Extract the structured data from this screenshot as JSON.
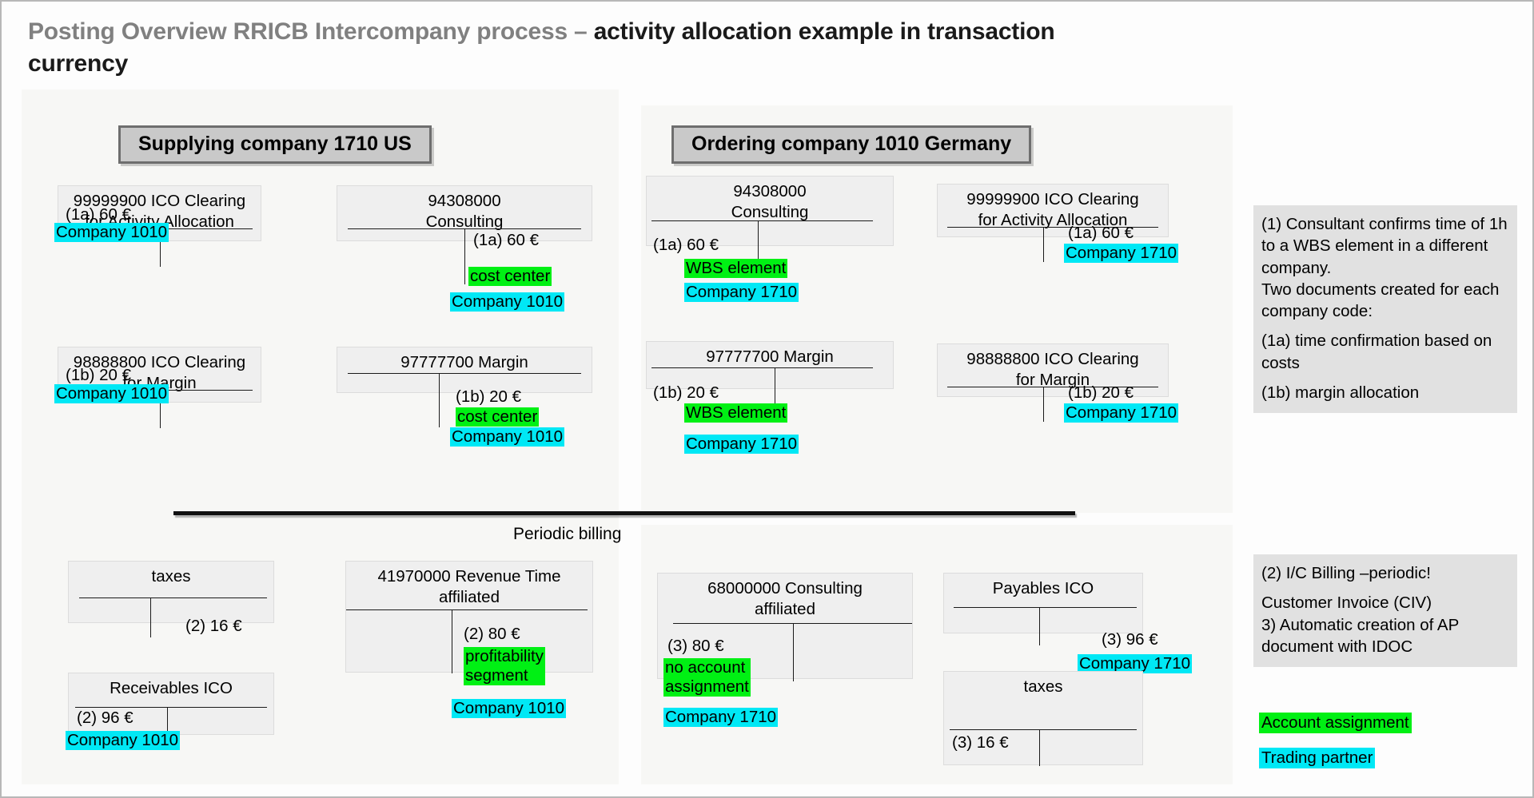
{
  "title": {
    "lead": "Posting Overview RRICB Intercompany process – ",
    "accent": "activity allocation example in transaction currency"
  },
  "colors": {
    "account_assignment_highlight": "#00f014",
    "trading_partner_highlight": "#00e8f5",
    "banner_fill": "#c9c9c9",
    "banner_border": "#6e6e6e",
    "t_account_fill": "#efefef",
    "panel_fill": "#f7f7f5",
    "note_fill": "#e1e1e1",
    "title_gray": "#808080"
  },
  "banners": {
    "supplying": "Supplying company 1710 US",
    "ordering": "Ordering company 1010 Germany"
  },
  "periodic": {
    "label": "Periodic billing"
  },
  "accounts": {
    "a1": {
      "header": "99999900 ICO Clearing\nfor Activity Allocation",
      "debit": "(1a) 60 €",
      "credit": "",
      "trading_partner": "Company 1010",
      "assignment": ""
    },
    "a2": {
      "header": "94308000\nConsulting",
      "debit": "",
      "credit": "(1a) 60 €",
      "assignment": "cost center",
      "trading_partner": "Company 1010"
    },
    "a3": {
      "header": "94308000\nConsulting",
      "debit": "(1a) 60 €",
      "credit": "",
      "assignment": "WBS element",
      "trading_partner": "Company 1710"
    },
    "a4": {
      "header": "99999900 ICO Clearing\nfor Activity Allocation",
      "debit": "",
      "credit": "(1a) 60 €",
      "assignment": "",
      "trading_partner": "Company 1710"
    },
    "b1": {
      "header": "98888800 ICO Clearing\nfor Margin",
      "debit": "(1b) 20 €",
      "credit": "",
      "assignment": "",
      "trading_partner": "Company 1010"
    },
    "b2": {
      "header": "97777700 Margin",
      "debit": "",
      "credit": "(1b) 20 €",
      "assignment": "cost center",
      "trading_partner": "Company 1010"
    },
    "b3": {
      "header": "97777700 Margin",
      "debit": "(1b) 20 €",
      "credit": "",
      "assignment": "WBS element",
      "trading_partner": "Company 1710"
    },
    "b4": {
      "header": "98888800 ICO Clearing\nfor Margin",
      "debit": "",
      "credit": "(1b) 20 €",
      "assignment": "",
      "trading_partner": "Company 1710"
    },
    "c1": {
      "header": "taxes",
      "debit": "",
      "credit": "(2) 16 €",
      "assignment": "",
      "trading_partner": ""
    },
    "c2": {
      "header": "Receivables ICO",
      "debit": "(2) 96 €",
      "credit": "",
      "assignment": "",
      "trading_partner": "Company 1010"
    },
    "c3": {
      "header": "41970000 Revenue Time\naffiliated",
      "debit": "",
      "credit": "(2) 80 €",
      "assignment": "profitability\nsegment",
      "trading_partner": "Company 1010"
    },
    "d1": {
      "header": "68000000 Consulting\naffiliated",
      "debit": "(3) 80 €",
      "credit": "",
      "assignment": "no account\nassignment",
      "trading_partner": "Company 1710"
    },
    "d2": {
      "header": "Payables ICO",
      "debit": "",
      "credit": "(3) 96 €",
      "assignment": "",
      "trading_partner": "Company 1710"
    },
    "d3": {
      "header": "taxes",
      "debit": "(3) 16 €",
      "credit": "",
      "assignment": "",
      "trading_partner": ""
    }
  },
  "notes": {
    "note1": {
      "line1": "(1)  Consultant confirms time of 1h to a WBS element in a different company.",
      "line2": "Two documents created for each company code:",
      "line3": "(1a) time confirmation based on costs",
      "line4": "(1b) margin allocation"
    },
    "note2": {
      "line1": "(2)  I/C Billing –periodic!",
      "line2": "Customer Invoice (CIV)",
      "line3": "3) Automatic creation of AP document with IDOC"
    }
  },
  "legend": {
    "green": "Account assignment",
    "cyan": "Trading partner"
  }
}
